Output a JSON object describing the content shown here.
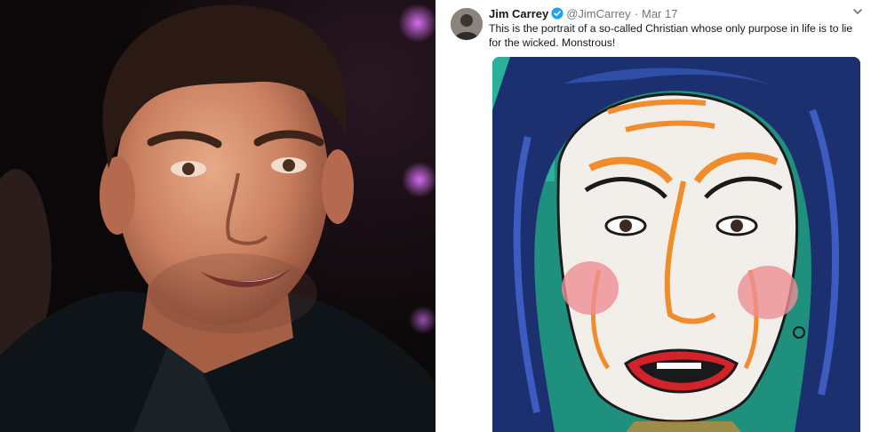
{
  "tweet": {
    "author_name": "Jim Carrey",
    "handle": "@JimCarrey",
    "separator": "·",
    "date": "Mar 17",
    "text": "This is the portrait of a so-called Christian whose only purpose in life is to lie for the wicked. Monstrous!",
    "icons": {
      "verified": "verified-badge-icon",
      "menu": "chevron-down-icon"
    },
    "colors": {
      "verified_blue": "#1da1f2",
      "secondary_text": "#657786"
    }
  },
  "images": {
    "left": "portrait-photo",
    "right": "painted-portrait"
  }
}
